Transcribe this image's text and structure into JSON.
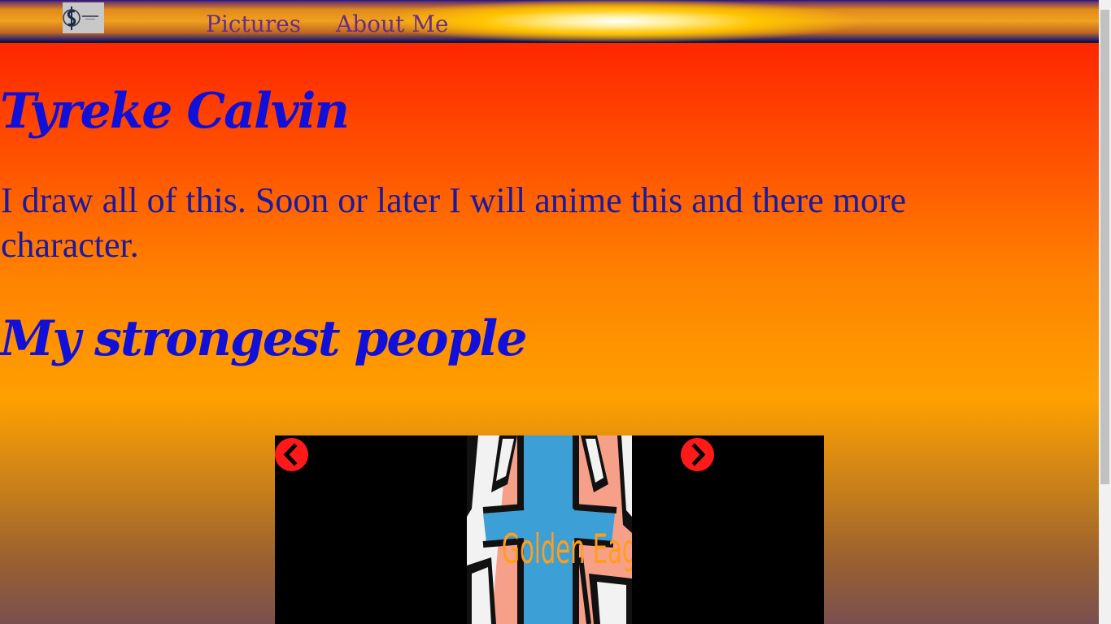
{
  "nav": {
    "logo_icon": "dollar-sign-logo-icon",
    "links": [
      {
        "label": "Pictures"
      },
      {
        "label": "About Me"
      }
    ]
  },
  "header": {
    "name": "Tyreke Calvin"
  },
  "intro": {
    "text": "I draw all of this. Soon or later I will anime this and there more character."
  },
  "section": {
    "title": "My strongest people"
  },
  "slideshow": {
    "caption": "Golden Eagle",
    "prev_icon": "chevron-left-icon",
    "next_icon": "chevron-right-icon"
  },
  "colors": {
    "heading": "#1010d8",
    "text": "#1a1aa0",
    "nav_link": "#6a2a8a",
    "caption": "#ff9e1a",
    "slide_button": "#ff1a1a"
  }
}
